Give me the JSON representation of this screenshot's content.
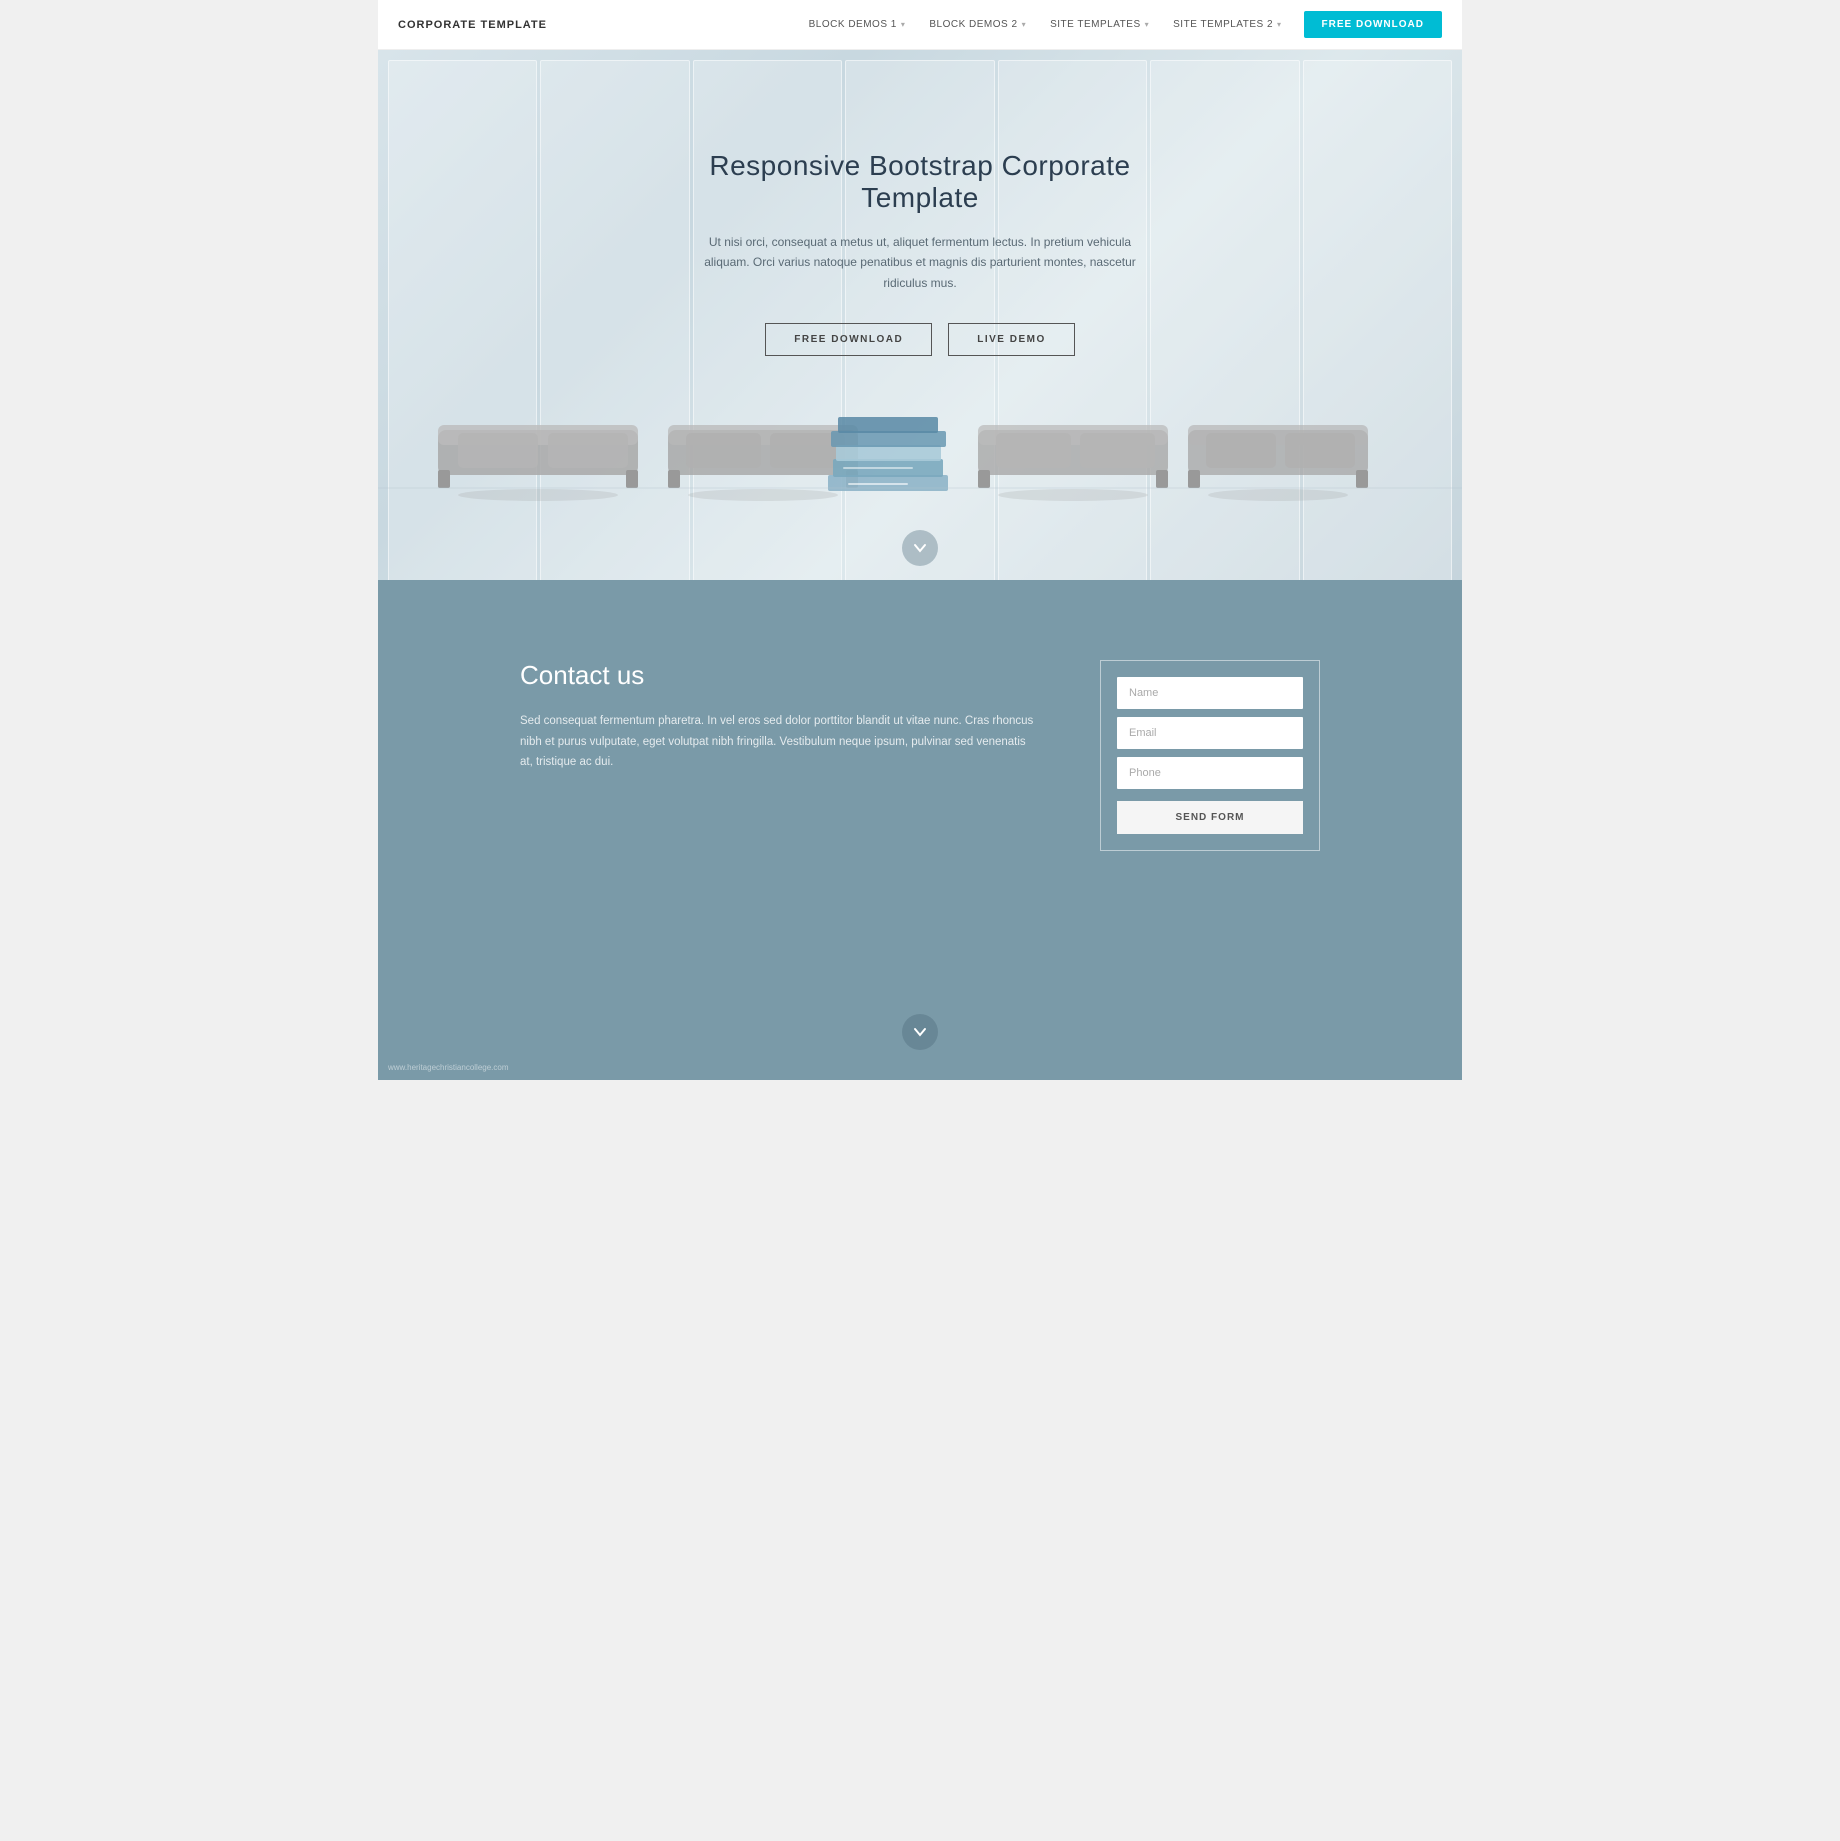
{
  "nav": {
    "brand": "CORPORATE TEMPLATE",
    "items": [
      {
        "label": "BLOCK DEMOS 1",
        "has_dropdown": true
      },
      {
        "label": "BLOCK DEMOS 2",
        "has_dropdown": true
      },
      {
        "label": "SITE TEMPLATES",
        "has_dropdown": true
      },
      {
        "label": "SITE TEMPLATES 2",
        "has_dropdown": true
      }
    ],
    "cta_button": "FREE DOWNLOAD"
  },
  "hero": {
    "title": "Responsive Bootstrap Corporate Template",
    "description": "Ut nisi orci, consequat a metus ut, aliquet fermentum lectus. In pretium vehicula aliquam. Orci varius natoque penatibus et magnis dis parturient montes, nascetur ridiculus mus.",
    "btn_download": "FREE DOWNLOAD",
    "btn_demo": "LIVE DEMO"
  },
  "contact": {
    "title": "Contact us",
    "description": "Sed consequat fermentum pharetra. In vel eros sed dolor porttitor blandit ut vitae nunc. Cras rhoncus nibh et purus vulputate, eget volutpat nibh fringilla. Vestibulum neque ipsum, pulvinar sed venenatis at, tristique ac dui.",
    "form": {
      "name_placeholder": "Name",
      "email_placeholder": "Email",
      "phone_placeholder": "Phone",
      "submit_label": "SEND FORM"
    }
  },
  "footer": {
    "url": "www.heritagechristiancollege.com"
  }
}
